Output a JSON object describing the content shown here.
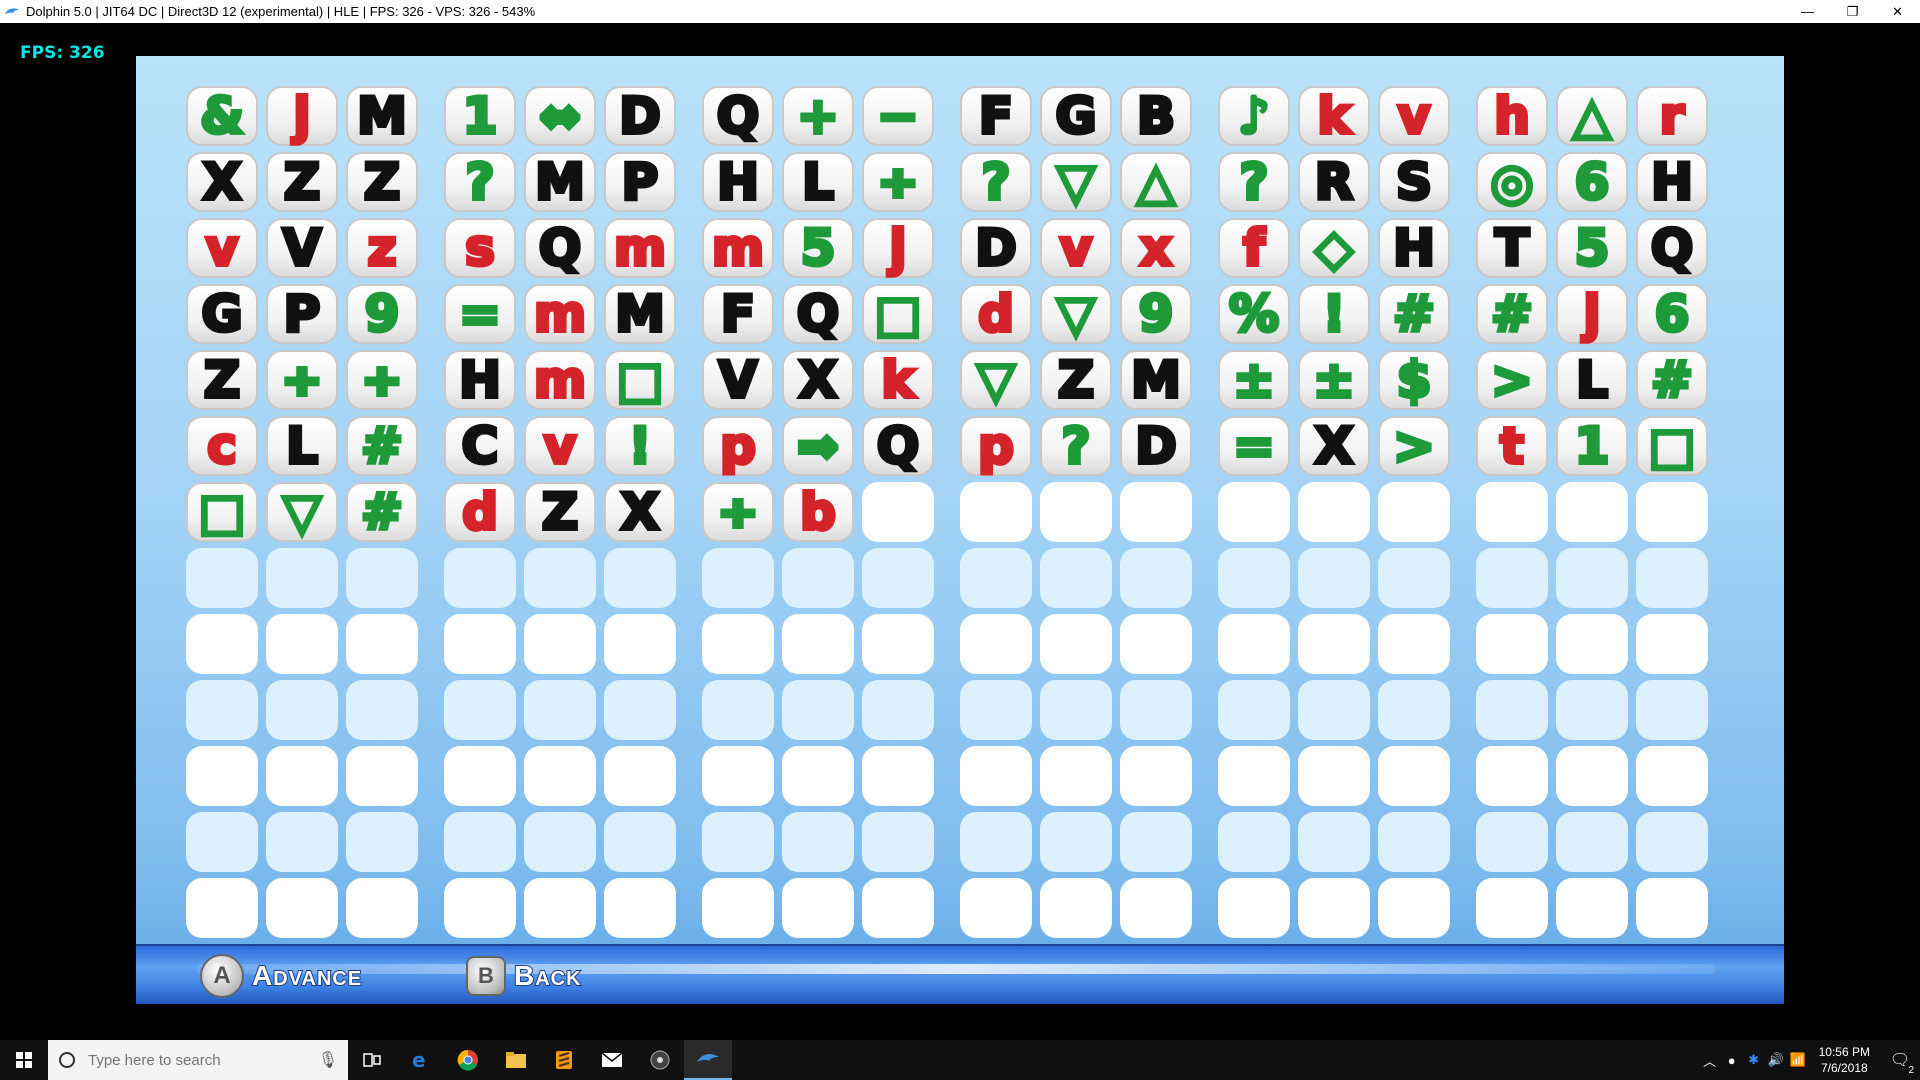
{
  "window": {
    "title": "Dolphin 5.0 | JIT64 DC | Direct3D 12 (experimental) | HLE | FPS: 326 - VPS: 326 - 543%",
    "icon": "dolphin-icon",
    "minimize": "—",
    "restore": "❐",
    "close": "✕"
  },
  "overlay": {
    "fps_text": "FPS: 326"
  },
  "grid": {
    "rows": [
      [
        [
          "&",
          "g"
        ],
        [
          "j",
          "r"
        ],
        [
          "M",
          "k"
        ],
        [
          "1",
          "g"
        ],
        [
          "⇔",
          "g"
        ],
        [
          "D",
          "k"
        ],
        [
          "Q",
          "k"
        ],
        [
          "+",
          "g"
        ],
        [
          "−",
          "g"
        ],
        [
          "F",
          "k"
        ],
        [
          "G",
          "k"
        ],
        [
          "B",
          "k"
        ],
        [
          "♪",
          "g"
        ],
        [
          "k",
          "r"
        ],
        [
          "v",
          "r"
        ],
        [
          "h",
          "r"
        ],
        [
          "△",
          "g"
        ],
        [
          "r",
          "r"
        ]
      ],
      [
        [
          "X",
          "k"
        ],
        [
          "Z",
          "k"
        ],
        [
          "Z",
          "k"
        ],
        [
          "?",
          "g"
        ],
        [
          "M",
          "k"
        ],
        [
          "P",
          "k"
        ],
        [
          "H",
          "k"
        ],
        [
          "L",
          "k"
        ],
        [
          "÷",
          "g"
        ],
        [
          "?",
          "g"
        ],
        [
          "▽",
          "g"
        ],
        [
          "△",
          "g"
        ],
        [
          "?",
          "g"
        ],
        [
          "R",
          "k"
        ],
        [
          "S",
          "k"
        ],
        [
          "◎",
          "g"
        ],
        [
          "6",
          "g"
        ],
        [
          "H",
          "k"
        ]
      ],
      [
        [
          "v",
          "r"
        ],
        [
          "V",
          "k"
        ],
        [
          "z",
          "r"
        ],
        [
          "s",
          "r"
        ],
        [
          "Q",
          "k"
        ],
        [
          "m",
          "r"
        ],
        [
          "m",
          "r"
        ],
        [
          "5",
          "g"
        ],
        [
          "j",
          "r"
        ],
        [
          "D",
          "k"
        ],
        [
          "v",
          "r"
        ],
        [
          "x",
          "r"
        ],
        [
          "f",
          "r"
        ],
        [
          "◇",
          "g"
        ],
        [
          "H",
          "k"
        ],
        [
          "T",
          "k"
        ],
        [
          "5",
          "g"
        ],
        [
          "Q",
          "k"
        ]
      ],
      [
        [
          "G",
          "k"
        ],
        [
          "P",
          "k"
        ],
        [
          "9",
          "g"
        ],
        [
          "=",
          "g"
        ],
        [
          "m",
          "r"
        ],
        [
          "M",
          "k"
        ],
        [
          "F",
          "k"
        ],
        [
          "Q",
          "k"
        ],
        [
          "□",
          "g"
        ],
        [
          "d",
          "r"
        ],
        [
          "▽",
          "g"
        ],
        [
          "9",
          "g"
        ],
        [
          "%",
          "g"
        ],
        [
          "!",
          "g"
        ],
        [
          "#",
          "g"
        ],
        [
          "#",
          "g"
        ],
        [
          "j",
          "r"
        ],
        [
          "6",
          "g"
        ]
      ],
      [
        [
          "Z",
          "k"
        ],
        [
          "÷",
          "g"
        ],
        [
          "÷",
          "g"
        ],
        [
          "H",
          "k"
        ],
        [
          "m",
          "r"
        ],
        [
          "□",
          "g"
        ],
        [
          "V",
          "k"
        ],
        [
          "X",
          "k"
        ],
        [
          "k",
          "r"
        ],
        [
          "▽",
          "g"
        ],
        [
          "Z",
          "k"
        ],
        [
          "M",
          "k"
        ],
        [
          "±",
          "g"
        ],
        [
          "±",
          "g"
        ],
        [
          "$",
          "g"
        ],
        [
          ">",
          "g"
        ],
        [
          "L",
          "k"
        ],
        [
          "#",
          "g"
        ]
      ],
      [
        [
          "c",
          "r"
        ],
        [
          "L",
          "k"
        ],
        [
          "#",
          "g"
        ],
        [
          "C",
          "k"
        ],
        [
          "v",
          "r"
        ],
        [
          "!",
          "g"
        ],
        [
          "p",
          "r"
        ],
        [
          "⇒",
          "g"
        ],
        [
          "Q",
          "k"
        ],
        [
          "p",
          "r"
        ],
        [
          "?",
          "g"
        ],
        [
          "D",
          "k"
        ],
        [
          "=",
          "g"
        ],
        [
          "X",
          "k"
        ],
        [
          ">",
          "g"
        ],
        [
          "t",
          "r"
        ],
        [
          "1",
          "g"
        ],
        [
          "□",
          "g"
        ]
      ],
      [
        [
          "□",
          "g"
        ],
        [
          "▽",
          "g"
        ],
        [
          "#",
          "g"
        ],
        [
          "d",
          "r"
        ],
        [
          "Z",
          "k"
        ],
        [
          "X",
          "k"
        ],
        [
          "÷",
          "g"
        ],
        [
          "b",
          "r"
        ]
      ]
    ],
    "total_rows": 13,
    "columns": 18
  },
  "hints": {
    "a_button": "A",
    "a_label": "Advance",
    "b_button": "B",
    "b_label": "Back"
  },
  "taskbar": {
    "search_placeholder": "Type here to search",
    "time": "10:56 PM",
    "date": "7/6/2018",
    "notifications": "2",
    "apps": [
      "task-view-icon",
      "edge-icon",
      "chrome-icon",
      "file-explorer-icon",
      "sublime-icon",
      "mail-icon",
      "obs-icon",
      "dolphin-icon"
    ]
  },
  "colors": {
    "black_symbol": "#111111",
    "red_symbol": "#d4232a",
    "green_symbol": "#1e9a3a",
    "fps": "#00e5e5"
  }
}
